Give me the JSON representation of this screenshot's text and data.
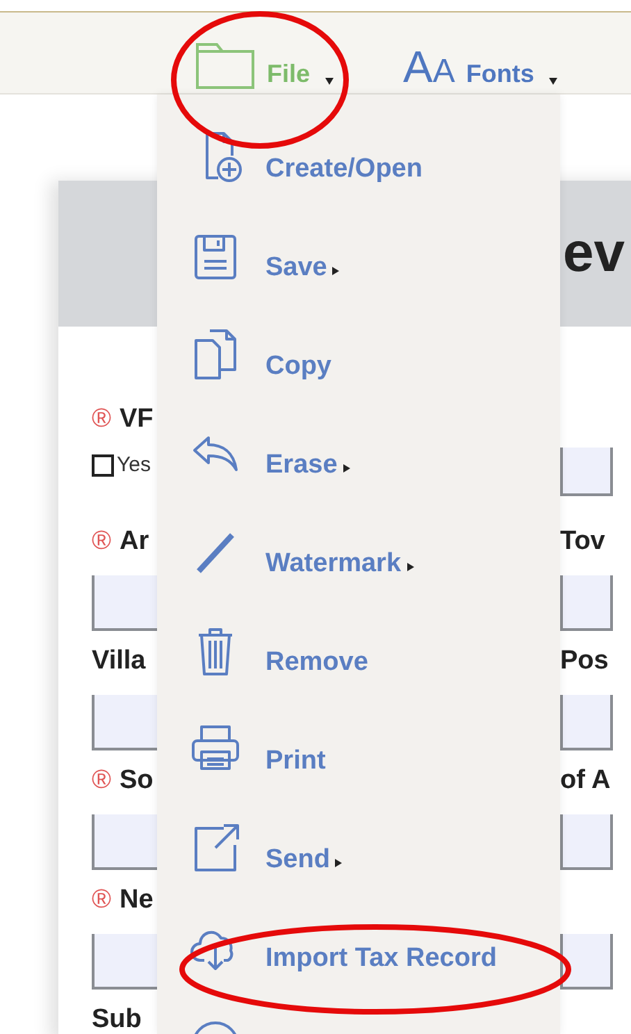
{
  "toolbar": [
    {
      "label": "File",
      "has_submenu": true,
      "expanded": true,
      "circled": true
    },
    {
      "label": "Fonts",
      "icon_glyphs": [
        "A",
        "A"
      ],
      "has_submenu": true,
      "expanded": false,
      "circled": false
    }
  ],
  "menu": {
    "items": [
      {
        "label": "Create/Open",
        "has_submenu": false,
        "circled": false
      },
      {
        "label": "Save",
        "has_submenu": true,
        "circled": false
      },
      {
        "label": "Copy",
        "has_submenu": false,
        "circled": false
      },
      {
        "label": "Erase",
        "has_submenu": true,
        "circled": false
      },
      {
        "label": "Watermark",
        "has_submenu": true,
        "circled": false
      },
      {
        "label": "Remove",
        "has_submenu": false,
        "circled": false
      },
      {
        "label": "Print",
        "has_submenu": false,
        "circled": false
      },
      {
        "label": "Send",
        "has_submenu": true,
        "circled": false
      },
      {
        "label": "Import Tax Record",
        "has_submenu": false,
        "circled": true
      }
    ]
  },
  "form": {
    "title": "ev",
    "rows": [
      {
        "left": {
          "kind": "label",
          "mark": "®",
          "text": "VF"
        }
      },
      {
        "left": {
          "kind": "checkbox",
          "text": "Yes",
          "checked": false
        },
        "right": {
          "kind": "input"
        }
      },
      {
        "left": {
          "kind": "label",
          "mark": "®",
          "text": "Ar"
        },
        "right": {
          "kind": "label",
          "text": "Tov"
        }
      },
      {
        "left": {
          "kind": "input"
        },
        "right": {
          "kind": "input"
        }
      },
      {
        "left": {
          "kind": "label",
          "text": "Villa"
        },
        "right": {
          "kind": "label",
          "text": "Pos"
        }
      },
      {
        "left": {
          "kind": "input"
        },
        "right": {
          "kind": "input"
        }
      },
      {
        "left": {
          "kind": "label",
          "mark": "®",
          "text": "So"
        },
        "right": {
          "kind": "label",
          "text": "of A"
        }
      },
      {
        "left": {
          "kind": "input"
        },
        "right": {
          "kind": "input"
        }
      },
      {
        "left": {
          "kind": "label",
          "mark": "®",
          "text": "Ne"
        }
      },
      {
        "left": {
          "kind": "input"
        },
        "right": {
          "kind": "input"
        }
      },
      {
        "left": {
          "kind": "label",
          "text": "Sub"
        }
      }
    ]
  }
}
